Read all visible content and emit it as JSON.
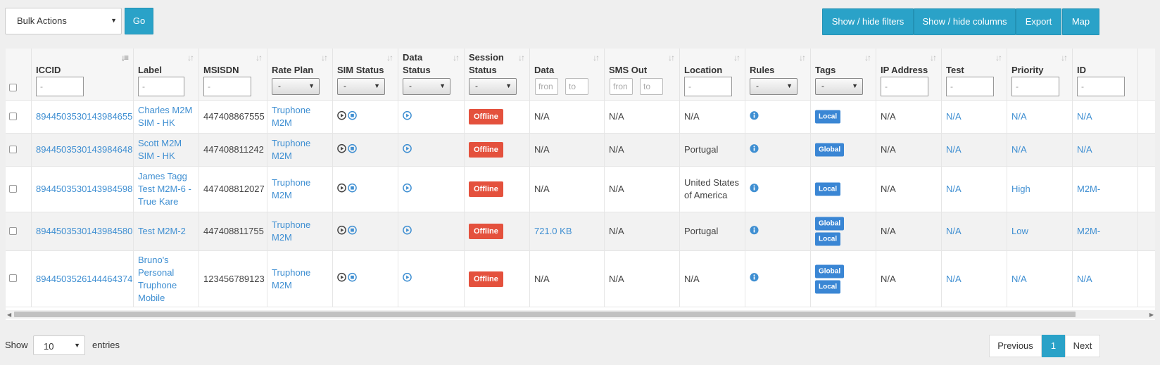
{
  "toolbar": {
    "bulk_actions": "Bulk Actions",
    "go": "Go",
    "show_hide_filters": "Show / hide filters",
    "show_hide_columns": "Show / hide columns",
    "export": "Export",
    "map": "Map"
  },
  "columns": {
    "iccid": "ICCID",
    "label": "Label",
    "msisdn": "MSISDN",
    "rate_plan": "Rate Plan",
    "sim_status": "SIM Status",
    "data_status": "Data Status",
    "session_status": "Session Status",
    "data": "Data",
    "sms_out": "SMS Out",
    "location": "Location",
    "rules": "Rules",
    "tags": "Tags",
    "ip_address": "IP Address",
    "test": "Test",
    "priority": "Priority",
    "id": "ID"
  },
  "filters": {
    "text_placeholder": "-",
    "select_value": "-",
    "range_from": "fron",
    "range_to": "to"
  },
  "rows": [
    {
      "iccid": "8944503530143984655",
      "label": "Charles M2M SIM - HK",
      "msisdn": "447408867555",
      "rate_plan": "Truphone M2M",
      "session": "Offline",
      "data": "N/A",
      "sms_out": "N/A",
      "location": "N/A",
      "tags": [
        "Local"
      ],
      "ip_address": "N/A",
      "test": "N/A",
      "priority": "N/A",
      "id": "N/A"
    },
    {
      "iccid": "8944503530143984648",
      "label": "Scott M2M SIM - HK",
      "msisdn": "447408811242",
      "rate_plan": "Truphone M2M",
      "session": "Offline",
      "data": "N/A",
      "sms_out": "N/A",
      "location": "Portugal",
      "tags": [
        "Global"
      ],
      "ip_address": "N/A",
      "test": "N/A",
      "priority": "N/A",
      "id": "N/A"
    },
    {
      "iccid": "8944503530143984598",
      "label": "James Tagg Test M2M-6 - True Kare",
      "msisdn": "447408812027",
      "rate_plan": "Truphone M2M",
      "session": "Offline",
      "data": "N/A",
      "sms_out": "N/A",
      "location": "United States of America",
      "tags": [
        "Local"
      ],
      "ip_address": "N/A",
      "test": "N/A",
      "priority": "High",
      "id": "M2M-"
    },
    {
      "iccid": "8944503530143984580",
      "label": "Test M2M-2",
      "msisdn": "447408811755",
      "rate_plan": "Truphone M2M",
      "session": "Offline",
      "data": "721.0 KB",
      "sms_out": "N/A",
      "location": "Portugal",
      "tags": [
        "Global",
        "Local"
      ],
      "ip_address": "N/A",
      "test": "N/A",
      "priority": "Low",
      "id": "M2M-"
    },
    {
      "iccid": "8944503526144464374",
      "label": "Bruno's Personal Truphone Mobile",
      "msisdn": "123456789123",
      "rate_plan": "Truphone M2M",
      "session": "Offline",
      "data": "N/A",
      "sms_out": "N/A",
      "location": "N/A",
      "tags": [
        "Global",
        "Local"
      ],
      "ip_address": "N/A",
      "test": "N/A",
      "priority": "N/A",
      "id": "N/A"
    }
  ],
  "footer": {
    "show": "Show",
    "page_length": "10",
    "entries": "entries",
    "previous": "Previous",
    "page": "1",
    "next": "Next"
  },
  "colors": {
    "accent": "#2aa2c8",
    "link": "#3f8fd2",
    "offline": "#e4513d",
    "tag": "#3a86d4"
  },
  "icons": {
    "sort": "sort-arrows-icon",
    "play": "play-circle-icon",
    "stop": "stop-circle-icon",
    "info": "info-circle-icon"
  }
}
